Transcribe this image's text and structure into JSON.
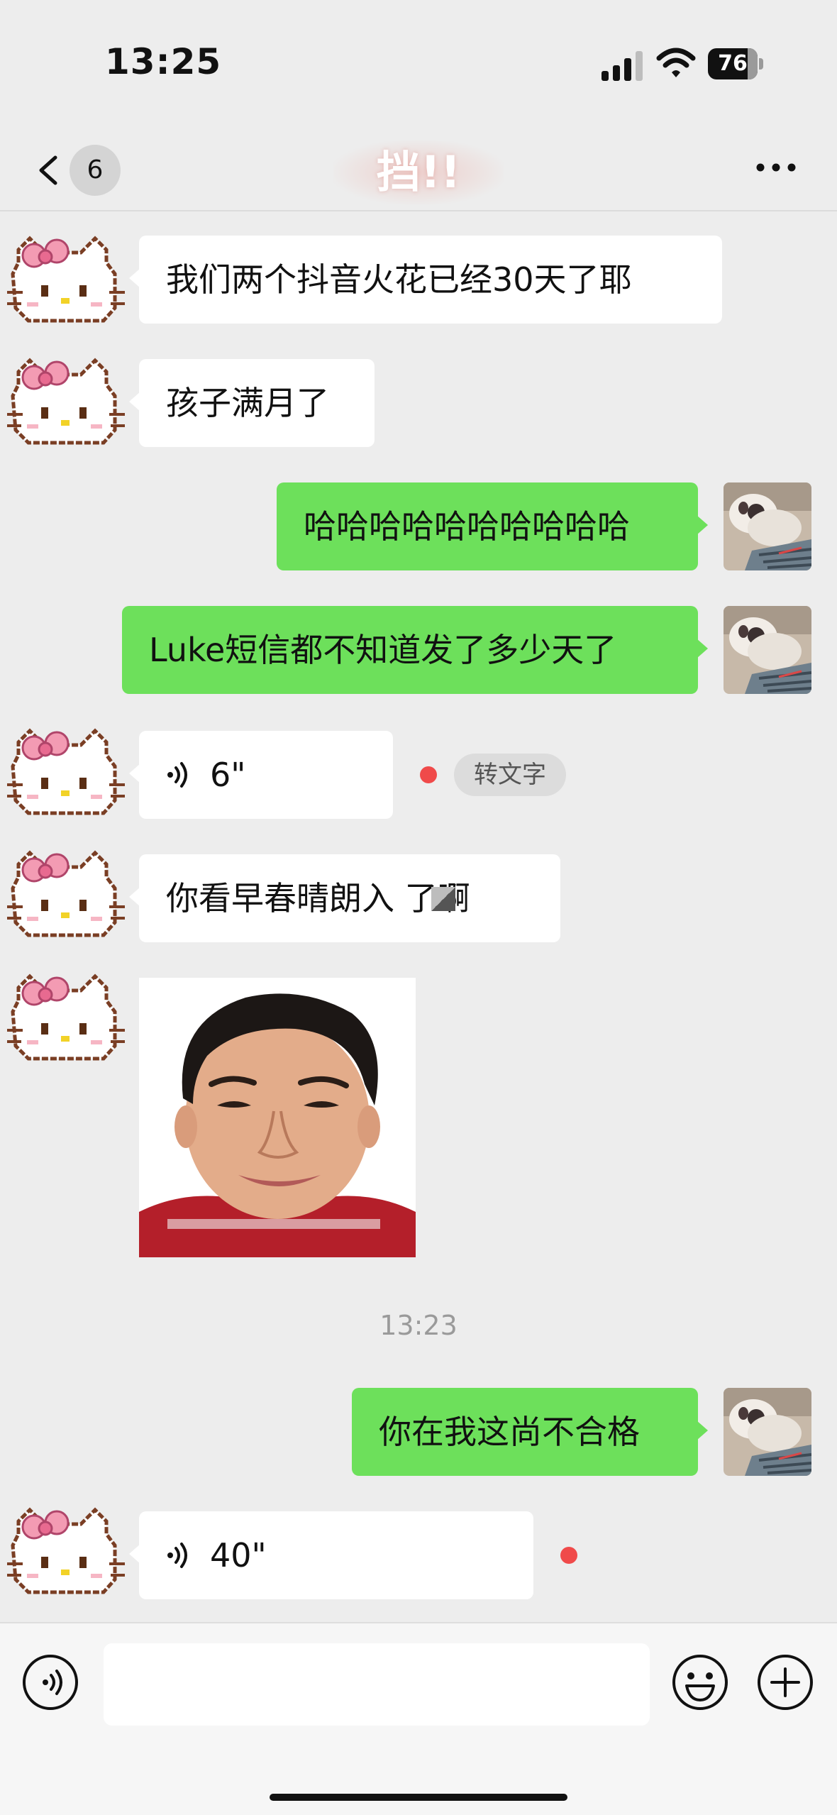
{
  "status_bar": {
    "time": "13:25",
    "battery": "76"
  },
  "nav": {
    "back_count": "6",
    "title": "挡!!",
    "more_icon": "more-horizontal-icon"
  },
  "messages": [
    {
      "side": "in",
      "type": "text",
      "text": "我们两个抖音火花已经30天了耶"
    },
    {
      "side": "in",
      "type": "text",
      "text": "孩子满月了"
    },
    {
      "side": "out",
      "type": "text",
      "text": "哈哈哈哈哈哈哈哈哈哈"
    },
    {
      "side": "out",
      "type": "text",
      "text": "Luke短信都不知道发了多少天了"
    },
    {
      "side": "in",
      "type": "voice",
      "duration": "6\"",
      "unread": true,
      "transcribe_label": "转文字"
    },
    {
      "side": "in",
      "type": "text",
      "text": "你看早春晴朗入 了啊"
    },
    {
      "side": "in",
      "type": "image"
    },
    {
      "type": "timestamp",
      "text": "13:23"
    },
    {
      "side": "out",
      "type": "text",
      "text": "你在我这尚不合格"
    },
    {
      "side": "in",
      "type": "voice",
      "duration": "40\"",
      "unread": true
    }
  ],
  "input_bar": {
    "value": "",
    "voice_icon": "voice-mode-icon",
    "emoji_icon": "emoji-icon",
    "plus_icon": "plus-icon"
  },
  "colors": {
    "background": "#ededed",
    "outgoing_bubble": "#6de05b",
    "incoming_bubble": "#ffffff",
    "unread_dot": "#f04a4a"
  }
}
